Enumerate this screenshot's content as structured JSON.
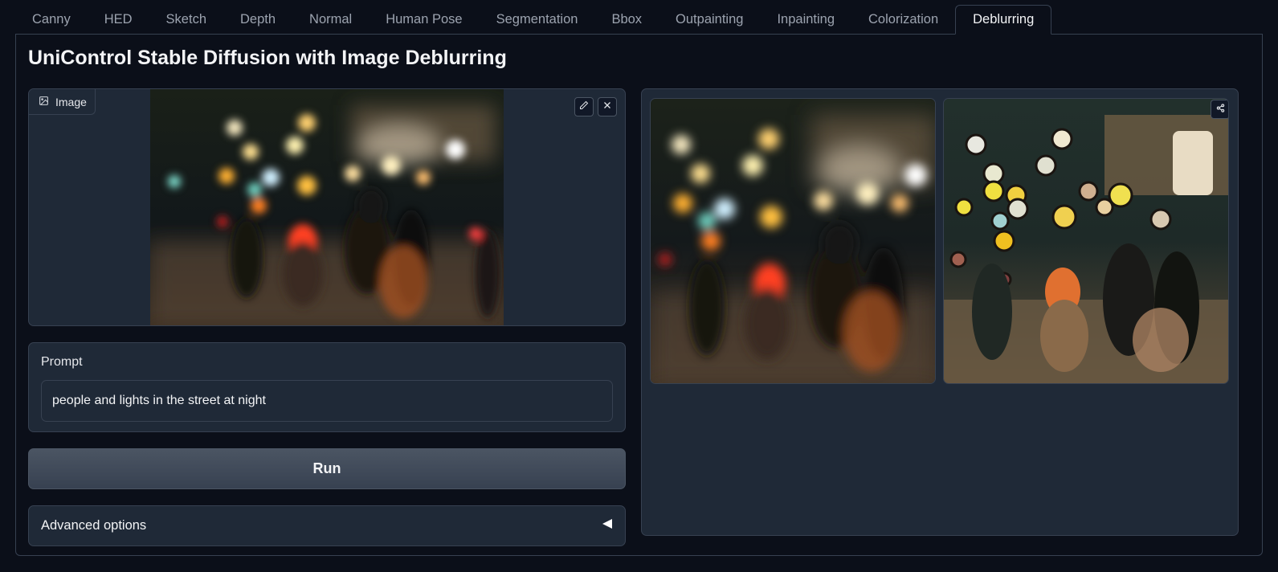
{
  "tabs": [
    "Canny",
    "HED",
    "Sketch",
    "Depth",
    "Normal",
    "Human Pose",
    "Segmentation",
    "Bbox",
    "Outpainting",
    "Inpainting",
    "Colorization",
    "Deblurring"
  ],
  "active_tab": "Deblurring",
  "page_title": "UniControl Stable Diffusion with Image Deblurring",
  "image_input": {
    "label": "Image",
    "label_icon": "image-icon",
    "edit_icon": "pencil-icon",
    "clear_icon": "close-icon"
  },
  "prompt": {
    "label": "Prompt",
    "value": "people and lights in the street at night"
  },
  "run_button": "Run",
  "advanced_options": {
    "label": "Advanced options",
    "icon": "triangle-left-icon"
  },
  "gallery": {
    "share_icon": "share-icon"
  },
  "colors": {
    "background": "#0b0f19",
    "panel": "#1f2937",
    "border": "#374151",
    "text": "#e5e7eb",
    "muted_text": "#9ca3af"
  }
}
